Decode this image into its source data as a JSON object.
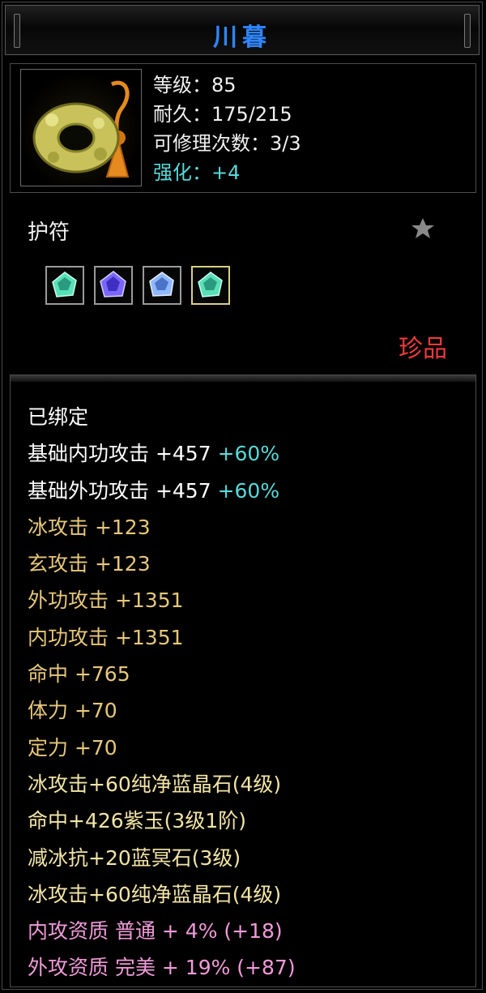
{
  "title": "川暮",
  "item": {
    "icon": "jade-ring-amulet-icon",
    "level_label": "等级：85",
    "durability_label": "耐久：175/215",
    "repair_label": "可修理次数：3/3",
    "enhance_label": "强化：+4"
  },
  "category": "护符",
  "star_icon": "star-icon",
  "gems": [
    {
      "icon": "green-crystal-gem-icon",
      "color": "#59e0b6"
    },
    {
      "icon": "purple-crystal-gem-icon",
      "color": "#7a66ff"
    },
    {
      "icon": "blue-crystal-gem-icon",
      "color": "#8fb8ff"
    },
    {
      "icon": "green-crystal-gem-icon",
      "color": "#59e0b6"
    }
  ],
  "rarity": "珍品",
  "attributes": {
    "bound": "已绑定",
    "base_inner": {
      "text": "基础内功攻击 +457 ",
      "bonus": "+60%"
    },
    "base_outer": {
      "text": "基础外功攻击 +457 ",
      "bonus": "+60%"
    },
    "lines_gold": [
      "冰攻击 +123",
      "玄攻击 +123",
      "外功攻击 +1351",
      "内功攻击 +1351",
      "命中 +765",
      "体力 +70",
      "定力 +70"
    ],
    "lines_gems": [
      "冰攻击+60纯净蓝晶石(4级)",
      "命中+426紫玉(3级1阶)",
      "减冰抗+20蓝冥石(3级)",
      "冰攻击+60纯净蓝晶石(4级)"
    ],
    "lines_quality": [
      "内攻资质 普通 + 4% (+18)",
      "外攻资质 完美 + 19% (+87)"
    ]
  },
  "colors": {
    "title": "#2f86ff",
    "rarity": "#ee3a3a",
    "enhance": "#59d9d9",
    "gold_attr": "#e7c77b",
    "gem_attr": "#f2e4a6",
    "quality_attr": "#f19ad9"
  }
}
